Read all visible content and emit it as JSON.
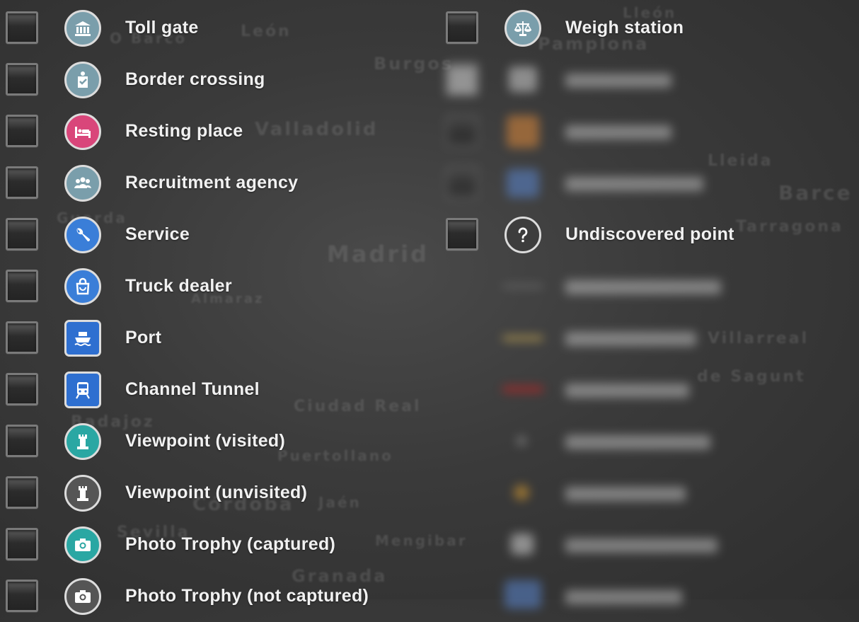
{
  "background_labels": [
    "León",
    "O Barco",
    "Burgos",
    "Pamplona",
    "Valladolid",
    "Lleida",
    "Barce",
    "Guarda",
    "Madrid",
    "Tarragona",
    "Almaraz",
    "Villarreal",
    "de Sagunt",
    "Ciudad Real",
    "Badajoz",
    "Puertollano",
    "Córdoba",
    "Jaén",
    "Sevilla",
    "Mengibar",
    "Granada",
    "Lleón"
  ],
  "left_items": [
    {
      "label": "Toll gate",
      "icon": "toll-gate-icon",
      "color": "#7a9eab"
    },
    {
      "label": "Border crossing",
      "icon": "border-crossing-icon",
      "color": "#7a9eab"
    },
    {
      "label": "Resting place",
      "icon": "bed-icon",
      "color": "#d9467a"
    },
    {
      "label": "Recruitment agency",
      "icon": "people-icon",
      "color": "#7a9eab"
    },
    {
      "label": "Service",
      "icon": "wrench-icon",
      "color": "#3a7ed8"
    },
    {
      "label": "Truck dealer",
      "icon": "shopping-bag-icon",
      "color": "#3a7ed8"
    },
    {
      "label": "Port",
      "icon": "ship-icon",
      "color": "#2e6fd0"
    },
    {
      "label": "Channel Tunnel",
      "icon": "train-icon",
      "color": "#2e6fd0"
    },
    {
      "label": "Viewpoint (visited)",
      "icon": "tower-icon",
      "color": "#2aa7a3"
    },
    {
      "label": "Viewpoint (unvisited)",
      "icon": "tower-icon",
      "color": "#555555"
    },
    {
      "label": "Photo Trophy (captured)",
      "icon": "camera-icon",
      "color": "#2aa7a3"
    },
    {
      "label": "Photo Trophy (not captured)",
      "icon": "camera-icon",
      "color": "#555555"
    }
  ],
  "right_items": [
    {
      "label": "Weigh station",
      "icon": "scales-icon",
      "color": "#7a9eab"
    },
    {
      "label": "Undiscovered point",
      "icon": "question-icon",
      "color": "#3d3d3d"
    }
  ],
  "colors": {
    "background": "#3a3a3a",
    "text": "#f1f1f1",
    "blurred_orange": "#e08a3a",
    "blurred_blue": "#5a86d0",
    "blurred_yellow_road": "#e6c15a",
    "blurred_red_route": "#d22020",
    "blurred_city_dot": "#e0a030"
  }
}
